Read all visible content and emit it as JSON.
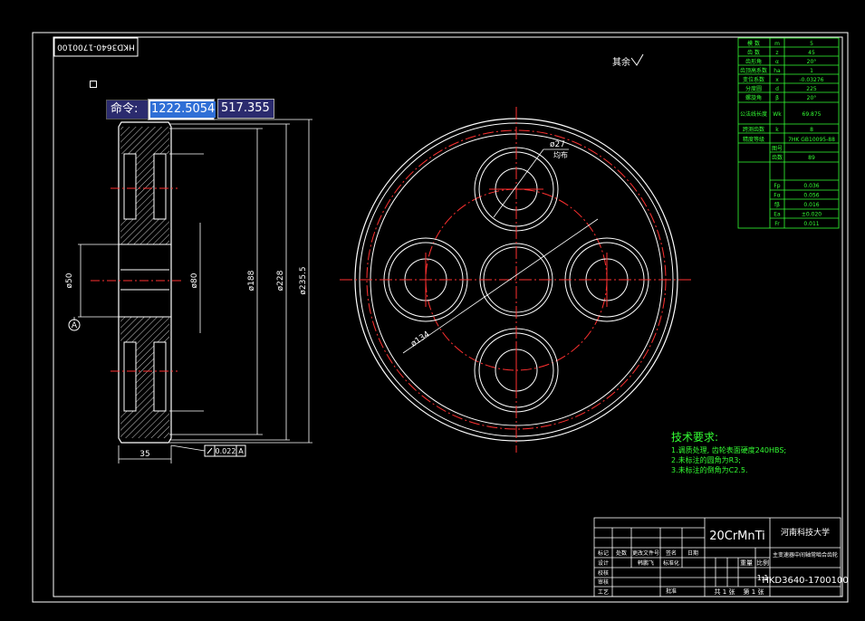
{
  "drawing_number_rotated": "HKD3640-1700100",
  "roughness_note": "其余",
  "command": {
    "label": "命令:",
    "x_value": "1222.5054",
    "y_value": "517.355"
  },
  "datum_label": "A",
  "dimensions": {
    "width_35": "35",
    "bore_50": "ø50",
    "hub_80": "ø80",
    "web_188": "ø188",
    "root_228": "ø228",
    "tip_235": "ø235.5",
    "hole_27": "ø27",
    "hole_note": "均布",
    "pitch_circle_134": "ø134",
    "runout_tol": "0.022",
    "runout_datum": "A"
  },
  "gear_params": [
    {
      "name": "模 数",
      "sym": "m",
      "val": "5"
    },
    {
      "name": "齿 数",
      "sym": "z",
      "val": "45"
    },
    {
      "name": "齿形角",
      "sym": "α",
      "val": "20°"
    },
    {
      "name": "齿顶高系数",
      "sym": "ha",
      "val": "1"
    },
    {
      "name": "变位系数",
      "sym": "x",
      "val": "-0.03276"
    },
    {
      "name": "分度圆",
      "sym": "d",
      "val": "225"
    },
    {
      "name": "螺旋角",
      "sym": "β",
      "val": "20°"
    },
    {
      "name": "公法线长度",
      "sym": "Wk",
      "val": "69.875"
    },
    {
      "name": "跨测齿数",
      "sym": "k",
      "val": "8"
    },
    {
      "name": "精度等级",
      "sym": "",
      "val": "7HK GB10095-88"
    }
  ],
  "mesh_rows": [
    {
      "a": "图号",
      "b": ""
    },
    {
      "a": "齿数",
      "b": "89"
    }
  ],
  "tol_rows": [
    {
      "sym": "Fp",
      "val": "0.036"
    },
    {
      "sym": "Fα",
      "val": "0.056"
    },
    {
      "sym": "fβ",
      "val": "0.016"
    },
    {
      "sym": "Ea",
      "val": "±0.020"
    },
    {
      "sym": "Fr",
      "val": "0.011"
    }
  ],
  "tech_req": {
    "title": "技术要求:",
    "lines": [
      "1.调质处理, 齿轮表面硬度240HBS;",
      "2.未标注的圆角为R3;",
      "3.未标注的倒角为C2.5."
    ]
  },
  "title_block": {
    "material": "20CrMnTi",
    "school": "河南科技大学",
    "part_name": "主变速器中间轴常啮合齿轮",
    "scale": "1:1",
    "drawing_no": "HKD3640-1700100",
    "sheets": "共 1 张",
    "sheet_no": "第 1 张",
    "row_labels": [
      "标记",
      "设计",
      "校核",
      "审核",
      "工艺"
    ],
    "header": [
      "标记",
      "处数",
      "更改文件号",
      "签名",
      "日期"
    ],
    "designer": "韩鹏飞",
    "std": "标准化",
    "approve": "批准",
    "weight": "重量",
    "scale_label": "比例"
  }
}
